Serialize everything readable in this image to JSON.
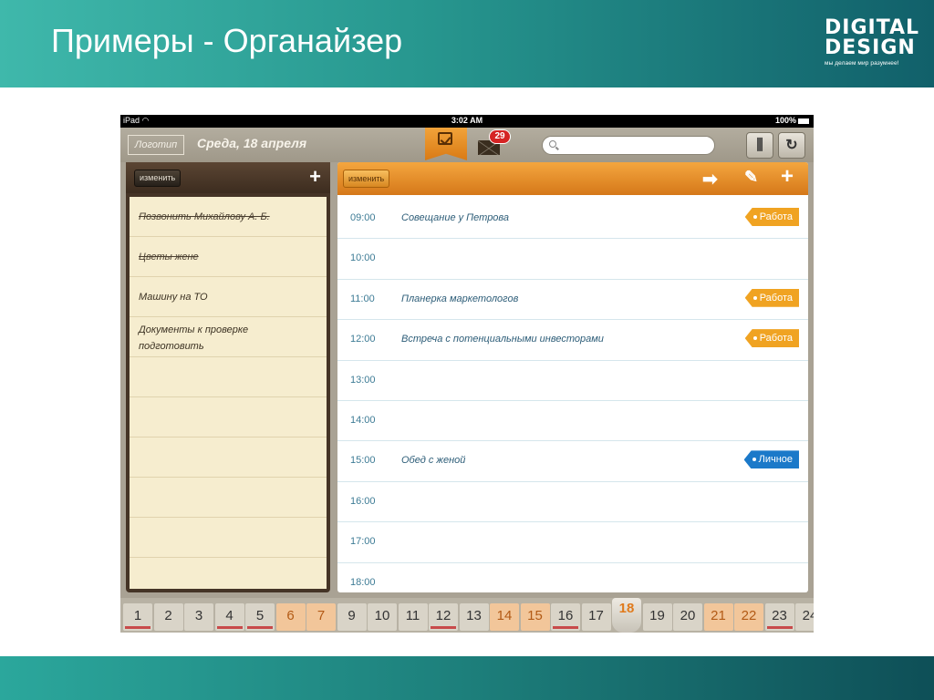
{
  "slide": {
    "title": "Примеры - Органайзер",
    "logo_line1": "DIGITAL",
    "logo_line2": "DESIGN",
    "logo_tagline": "мы делаем мир разумнее!"
  },
  "statusbar": {
    "device": "iPad",
    "time": "3:02 AM",
    "battery": "100%"
  },
  "topbar": {
    "logo_label": "Логотип",
    "date": "Среда, 18 апреля",
    "mail_badge": "29",
    "search_placeholder": ""
  },
  "todo": {
    "edit_label": "изменить",
    "add_icon": "plus-icon",
    "items": [
      {
        "text": "Позвонить Михайлову А. Б.",
        "done": true
      },
      {
        "text": "Цветы жене",
        "done": true
      },
      {
        "text": "Машину на ТО",
        "done": false
      },
      {
        "text": "Документы к проверке подготовить",
        "done": false
      }
    ]
  },
  "schedule": {
    "edit_label": "изменить",
    "rows": [
      {
        "time": "09:00",
        "event": "Совещание у Петрова",
        "tag": "Работа"
      },
      {
        "time": "10:00",
        "event": "",
        "tag": ""
      },
      {
        "time": "11:00",
        "event": "Планерка маркетологов",
        "tag": "Работа"
      },
      {
        "time": "12:00",
        "event": "Встреча с потенциальными инвесторами",
        "tag": "Работа"
      },
      {
        "time": "13:00",
        "event": "",
        "tag": ""
      },
      {
        "time": "14:00",
        "event": "",
        "tag": ""
      },
      {
        "time": "15:00",
        "event": "Обед с женой",
        "tag": "Личное"
      },
      {
        "time": "16:00",
        "event": "",
        "tag": ""
      },
      {
        "time": "17:00",
        "event": "",
        "tag": ""
      },
      {
        "time": "18:00",
        "event": "",
        "tag": ""
      }
    ]
  },
  "tag_colors": {
    "Работа": "#f0a322",
    "Личное": "#1b79c9"
  },
  "days": [
    {
      "label": "1",
      "weekend": false,
      "mark": true
    },
    {
      "label": "2",
      "weekend": false,
      "mark": false
    },
    {
      "label": "3",
      "weekend": false,
      "mark": false
    },
    {
      "label": "4",
      "weekend": false,
      "mark": true
    },
    {
      "label": "5",
      "weekend": false,
      "mark": true
    },
    {
      "label": "6",
      "weekend": true,
      "mark": false
    },
    {
      "label": "7",
      "weekend": true,
      "mark": false
    },
    {
      "label": "9",
      "weekend": false,
      "mark": false
    },
    {
      "label": "10",
      "weekend": false,
      "mark": false
    },
    {
      "label": "11",
      "weekend": false,
      "mark": false
    },
    {
      "label": "12",
      "weekend": false,
      "mark": true
    },
    {
      "label": "13",
      "weekend": false,
      "mark": false
    },
    {
      "label": "14",
      "weekend": true,
      "mark": false
    },
    {
      "label": "15",
      "weekend": true,
      "mark": false
    },
    {
      "label": "16",
      "weekend": false,
      "mark": true
    },
    {
      "label": "17",
      "weekend": false,
      "mark": false
    },
    {
      "label": "18",
      "weekend": false,
      "mark": false,
      "today": true
    },
    {
      "label": "19",
      "weekend": false,
      "mark": false
    },
    {
      "label": "20",
      "weekend": false,
      "mark": false
    },
    {
      "label": "21",
      "weekend": true,
      "mark": false
    },
    {
      "label": "22",
      "weekend": true,
      "mark": false
    },
    {
      "label": "23",
      "weekend": false,
      "mark": true
    },
    {
      "label": "24",
      "weekend": false,
      "mark": false
    }
  ]
}
